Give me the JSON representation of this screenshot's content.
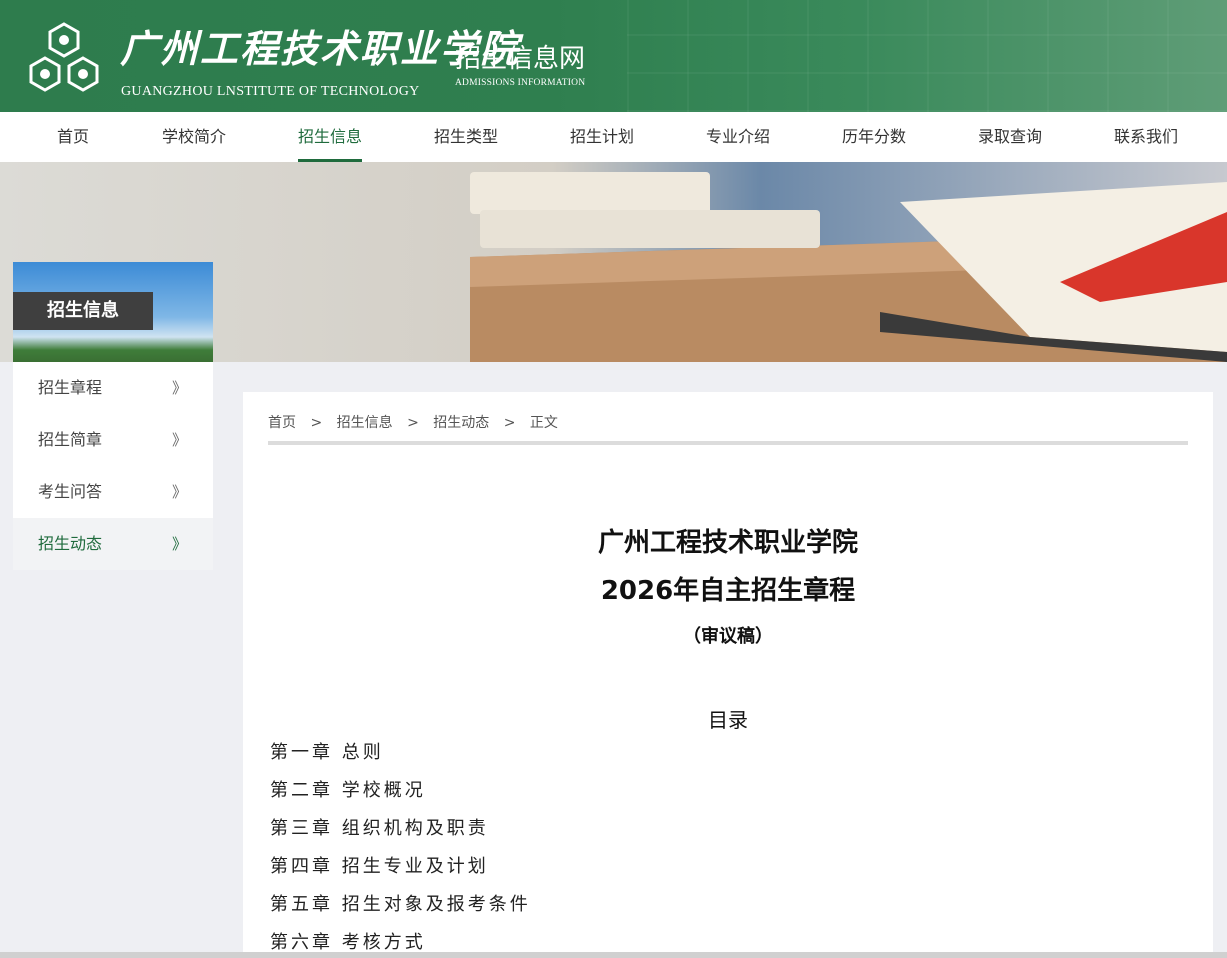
{
  "header": {
    "school_name": "广州工程技术职业学院",
    "school_name_en": "GUANGZHOU LNSTITUTE OF TECHNOLOGY",
    "site_title": "招生信息网",
    "site_subtitle": "ADMISSIONS INFORMATION",
    "logo_icon": "hexagon-logo-icon",
    "brand_color": "#2e7c4d"
  },
  "nav": {
    "items": [
      {
        "label": "首页"
      },
      {
        "label": "学校简介"
      },
      {
        "label": "招生信息",
        "active": true
      },
      {
        "label": "招生类型"
      },
      {
        "label": "招生计划"
      },
      {
        "label": "专业介绍"
      },
      {
        "label": "历年分数"
      },
      {
        "label": "录取查询"
      },
      {
        "label": "联系我们"
      }
    ],
    "active_color": "#1f6b3d"
  },
  "sidebar": {
    "title": "招生信息",
    "items": [
      {
        "label": "招生章程",
        "chevron": "》"
      },
      {
        "label": "招生简章",
        "chevron": "》"
      },
      {
        "label": "考生问答",
        "chevron": "》"
      },
      {
        "label": "招生动态",
        "chevron": "》",
        "active": true
      }
    ]
  },
  "breadcrumb": {
    "items": [
      "首页",
      "招生信息",
      "招生动态",
      "正文"
    ],
    "separator": ">"
  },
  "article": {
    "title_line1": "广州工程技术职业学院",
    "title_line2": "2026年自主招生章程",
    "title_line3": "（审议稿）",
    "toc_title": "目录",
    "toc": [
      "第一章 总则",
      "第二章 学校概况",
      "第三章 组织机构及职责",
      "第四章 招生专业及计划",
      "第五章 招生对象及报考条件",
      "第六章 考核方式"
    ]
  }
}
